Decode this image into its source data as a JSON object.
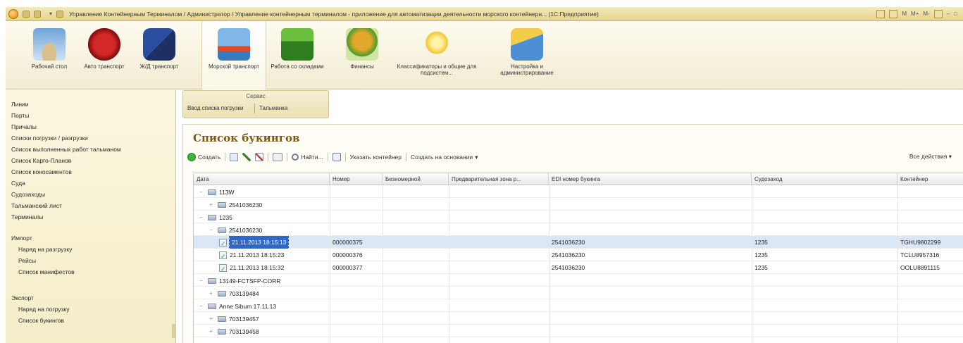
{
  "window": {
    "title": "Управление Контейнерным Терминалом / Администратор / Управление контейнерным терминалом - приложение для автоматизации деятельности морского контейнерн... (1С:Предприятие)",
    "right_controls": [
      "M",
      "M+",
      "M-"
    ]
  },
  "sections": [
    {
      "label": "Рабочий стол",
      "icon": "desktop-icon"
    },
    {
      "label": "Авто транспорт",
      "icon": "car-icon"
    },
    {
      "label": "Ж/Д транспорт",
      "icon": "train-icon"
    },
    {
      "label": "Морской транспорт",
      "icon": "ship-icon",
      "active": true
    },
    {
      "label": "Работа со складами",
      "icon": "warehouse-icon"
    },
    {
      "label": "Финансы",
      "icon": "finance-icon"
    },
    {
      "label": "Классификаторы и общие для подсистем...",
      "icon": "classifier-icon"
    },
    {
      "label": "Настройка и администрирование",
      "icon": "settings-icon"
    }
  ],
  "nav": {
    "items": [
      "Линии",
      "Порты",
      "Причалы",
      "Списки погрузки / разгрузки",
      "Список выполненных работ тальманом",
      "Список Карго-Планов",
      "Список коносаментов",
      "Суда",
      "Судозаходы",
      "Тальманский лист",
      "Терминалы"
    ],
    "import": {
      "title": "Импорт",
      "items": [
        "Наряд на разгрузку",
        "Рейсы",
        "Список манифестов"
      ]
    },
    "export": {
      "title": "Экспорт",
      "items": [
        "Наряд на погрузку",
        "Список букингов"
      ]
    }
  },
  "service": {
    "title": "Сервис",
    "items": [
      "Ввод списка погрузки",
      "Тальманка"
    ]
  },
  "form": {
    "title": "Список букингов",
    "toolbar": {
      "create": "Создать",
      "find": "Найти...",
      "specify_container": "Указать контейнер",
      "create_based_on": "Создать на основании",
      "all_actions": "Все действия"
    },
    "columns": [
      "Дата",
      "Номер",
      "Безномерной",
      "Предварительная зона р...",
      "EDI номер букинга",
      "Судозаход",
      "Контейнер"
    ],
    "rows": [
      {
        "level": 0,
        "type": "folder",
        "exp": "−",
        "date": "113W"
      },
      {
        "level": 1,
        "type": "folder",
        "exp": "+",
        "date": "2541036230"
      },
      {
        "level": 0,
        "type": "folder",
        "exp": "−",
        "date": "1235"
      },
      {
        "level": 1,
        "type": "folder",
        "exp": "−",
        "date": "2541036230"
      },
      {
        "level": 2,
        "type": "doc",
        "selected": true,
        "date": "21.11.2013 18:15:13",
        "number": "000000375",
        "edi": "2541036230",
        "call": "1235",
        "container": "TGHU9802299"
      },
      {
        "level": 2,
        "type": "doc",
        "date": "21.11.2013 18:15:23",
        "number": "000000376",
        "edi": "2541036230",
        "call": "1235",
        "container": "TCLU8957316"
      },
      {
        "level": 2,
        "type": "doc",
        "date": "21.11.2013 18:15:32",
        "number": "000000377",
        "edi": "2541036230",
        "call": "1235",
        "container": "OOLU8891115"
      },
      {
        "level": 0,
        "type": "folder",
        "exp": "−",
        "date": "13149-FCTSFP-CORR"
      },
      {
        "level": 1,
        "type": "folder",
        "exp": "+",
        "date": "703139484"
      },
      {
        "level": 0,
        "type": "folder",
        "exp": "−",
        "date": "Anne Sibum 17.11.13"
      },
      {
        "level": 1,
        "type": "folder",
        "exp": "+",
        "date": "703139457"
      },
      {
        "level": 1,
        "type": "folder",
        "exp": "+",
        "date": "703139458"
      }
    ]
  }
}
